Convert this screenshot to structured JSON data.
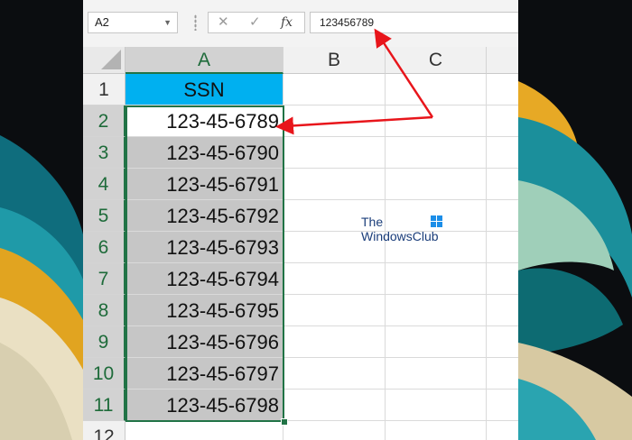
{
  "formula_bar": {
    "name_box": "A2",
    "cancel_icon": "✕",
    "enter_icon": "✓",
    "function_icon": "fx",
    "formula_value": "123456789"
  },
  "columns": [
    "A",
    "B",
    "C"
  ],
  "selected_column": "A",
  "rows": [
    {
      "number": "1",
      "value": "SSN"
    },
    {
      "number": "2",
      "value": "123-45-6789"
    },
    {
      "number": "3",
      "value": "123-45-6790"
    },
    {
      "number": "4",
      "value": "123-45-6791"
    },
    {
      "number": "5",
      "value": "123-45-6792"
    },
    {
      "number": "6",
      "value": "123-45-6793"
    },
    {
      "number": "7",
      "value": "123-45-6794"
    },
    {
      "number": "8",
      "value": "123-45-6795"
    },
    {
      "number": "9",
      "value": "123-45-6796"
    },
    {
      "number": "10",
      "value": "123-45-6797"
    },
    {
      "number": "11",
      "value": "123-45-6798"
    },
    {
      "number": "12",
      "value": ""
    }
  ],
  "header_fill_color": "#00b0f0",
  "selection_color": "#217346",
  "annotation_arrow_color": "#e8151b",
  "watermark": {
    "line1": "The",
    "line2": "WindowsClub"
  }
}
